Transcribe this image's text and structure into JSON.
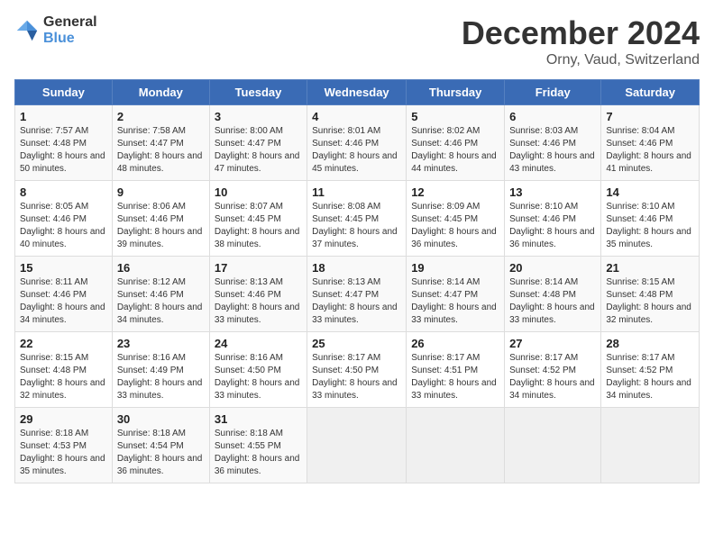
{
  "header": {
    "logo_general": "General",
    "logo_blue": "Blue",
    "title": "December 2024",
    "subtitle": "Orny, Vaud, Switzerland"
  },
  "days_of_week": [
    "Sunday",
    "Monday",
    "Tuesday",
    "Wednesday",
    "Thursday",
    "Friday",
    "Saturday"
  ],
  "weeks": [
    [
      {
        "day": "1",
        "sunrise": "7:57 AM",
        "sunset": "4:48 PM",
        "daylight": "8 hours and 50 minutes."
      },
      {
        "day": "2",
        "sunrise": "7:58 AM",
        "sunset": "4:47 PM",
        "daylight": "8 hours and 48 minutes."
      },
      {
        "day": "3",
        "sunrise": "8:00 AM",
        "sunset": "4:47 PM",
        "daylight": "8 hours and 47 minutes."
      },
      {
        "day": "4",
        "sunrise": "8:01 AM",
        "sunset": "4:46 PM",
        "daylight": "8 hours and 45 minutes."
      },
      {
        "day": "5",
        "sunrise": "8:02 AM",
        "sunset": "4:46 PM",
        "daylight": "8 hours and 44 minutes."
      },
      {
        "day": "6",
        "sunrise": "8:03 AM",
        "sunset": "4:46 PM",
        "daylight": "8 hours and 43 minutes."
      },
      {
        "day": "7",
        "sunrise": "8:04 AM",
        "sunset": "4:46 PM",
        "daylight": "8 hours and 41 minutes."
      }
    ],
    [
      {
        "day": "8",
        "sunrise": "8:05 AM",
        "sunset": "4:46 PM",
        "daylight": "8 hours and 40 minutes."
      },
      {
        "day": "9",
        "sunrise": "8:06 AM",
        "sunset": "4:46 PM",
        "daylight": "8 hours and 39 minutes."
      },
      {
        "day": "10",
        "sunrise": "8:07 AM",
        "sunset": "4:45 PM",
        "daylight": "8 hours and 38 minutes."
      },
      {
        "day": "11",
        "sunrise": "8:08 AM",
        "sunset": "4:45 PM",
        "daylight": "8 hours and 37 minutes."
      },
      {
        "day": "12",
        "sunrise": "8:09 AM",
        "sunset": "4:45 PM",
        "daylight": "8 hours and 36 minutes."
      },
      {
        "day": "13",
        "sunrise": "8:10 AM",
        "sunset": "4:46 PM",
        "daylight": "8 hours and 36 minutes."
      },
      {
        "day": "14",
        "sunrise": "8:10 AM",
        "sunset": "4:46 PM",
        "daylight": "8 hours and 35 minutes."
      }
    ],
    [
      {
        "day": "15",
        "sunrise": "8:11 AM",
        "sunset": "4:46 PM",
        "daylight": "8 hours and 34 minutes."
      },
      {
        "day": "16",
        "sunrise": "8:12 AM",
        "sunset": "4:46 PM",
        "daylight": "8 hours and 34 minutes."
      },
      {
        "day": "17",
        "sunrise": "8:13 AM",
        "sunset": "4:46 PM",
        "daylight": "8 hours and 33 minutes."
      },
      {
        "day": "18",
        "sunrise": "8:13 AM",
        "sunset": "4:47 PM",
        "daylight": "8 hours and 33 minutes."
      },
      {
        "day": "19",
        "sunrise": "8:14 AM",
        "sunset": "4:47 PM",
        "daylight": "8 hours and 33 minutes."
      },
      {
        "day": "20",
        "sunrise": "8:14 AM",
        "sunset": "4:48 PM",
        "daylight": "8 hours and 33 minutes."
      },
      {
        "day": "21",
        "sunrise": "8:15 AM",
        "sunset": "4:48 PM",
        "daylight": "8 hours and 32 minutes."
      }
    ],
    [
      {
        "day": "22",
        "sunrise": "8:15 AM",
        "sunset": "4:48 PM",
        "daylight": "8 hours and 32 minutes."
      },
      {
        "day": "23",
        "sunrise": "8:16 AM",
        "sunset": "4:49 PM",
        "daylight": "8 hours and 33 minutes."
      },
      {
        "day": "24",
        "sunrise": "8:16 AM",
        "sunset": "4:50 PM",
        "daylight": "8 hours and 33 minutes."
      },
      {
        "day": "25",
        "sunrise": "8:17 AM",
        "sunset": "4:50 PM",
        "daylight": "8 hours and 33 minutes."
      },
      {
        "day": "26",
        "sunrise": "8:17 AM",
        "sunset": "4:51 PM",
        "daylight": "8 hours and 33 minutes."
      },
      {
        "day": "27",
        "sunrise": "8:17 AM",
        "sunset": "4:52 PM",
        "daylight": "8 hours and 34 minutes."
      },
      {
        "day": "28",
        "sunrise": "8:17 AM",
        "sunset": "4:52 PM",
        "daylight": "8 hours and 34 minutes."
      }
    ],
    [
      {
        "day": "29",
        "sunrise": "8:18 AM",
        "sunset": "4:53 PM",
        "daylight": "8 hours and 35 minutes."
      },
      {
        "day": "30",
        "sunrise": "8:18 AM",
        "sunset": "4:54 PM",
        "daylight": "8 hours and 36 minutes."
      },
      {
        "day": "31",
        "sunrise": "8:18 AM",
        "sunset": "4:55 PM",
        "daylight": "8 hours and 36 minutes."
      },
      null,
      null,
      null,
      null
    ]
  ]
}
